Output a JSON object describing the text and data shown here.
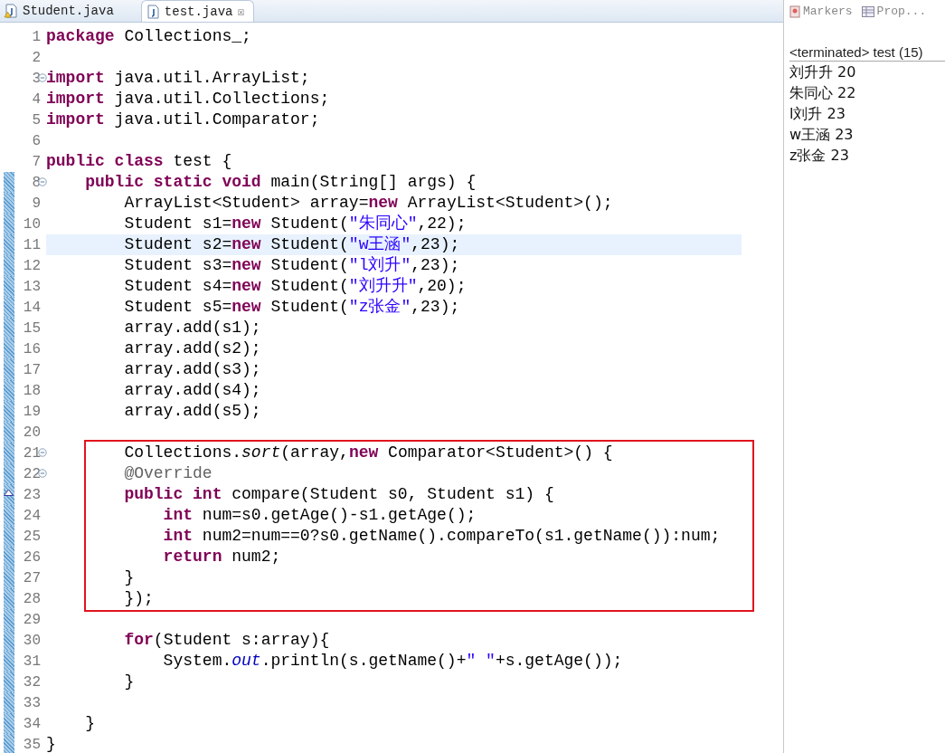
{
  "editor_tabs": [
    {
      "label": "Student.java",
      "selected": false,
      "warning": true
    },
    {
      "label": "test.java",
      "selected": true,
      "warning": false,
      "close": "☒"
    }
  ],
  "code_lines": [
    {
      "number": "1",
      "current": false,
      "boxed": false,
      "range": false,
      "tokens": [
        {
          "kind": "keyword",
          "text": "package"
        },
        {
          "kind": "plain",
          "text": " Collections_;"
        }
      ]
    },
    {
      "number": "2",
      "current": false,
      "boxed": false,
      "range": false
    },
    {
      "number": "3",
      "current": false,
      "boxed": false,
      "range": false,
      "kind": "fold",
      "tokens": [
        {
          "kind": "keyword",
          "text": "import"
        },
        {
          "kind": "plain",
          "text": " java.util.ArrayList;"
        }
      ]
    },
    {
      "number": "4",
      "current": false,
      "boxed": false,
      "range": false,
      "tokens": [
        {
          "kind": "keyword",
          "text": "import"
        },
        {
          "kind": "plain",
          "text": " java.util.Collections;"
        }
      ]
    },
    {
      "number": "5",
      "current": false,
      "boxed": false,
      "range": false,
      "tokens": [
        {
          "kind": "keyword",
          "text": "import"
        },
        {
          "kind": "plain",
          "text": " java.util.Comparator;"
        }
      ]
    },
    {
      "number": "6",
      "current": false,
      "boxed": false,
      "range": false
    },
    {
      "number": "7",
      "current": false,
      "boxed": false,
      "range": false,
      "tokens": [
        {
          "kind": "keyword",
          "text": "public class"
        },
        {
          "kind": "plain",
          "text": " test {"
        }
      ]
    },
    {
      "number": "8",
      "current": false,
      "boxed": false,
      "range": true,
      "kind": "fold",
      "tokens": [
        {
          "kind": "keyword",
          "text": "    public static void"
        },
        {
          "kind": "plain",
          "text": " main(String[] args) {"
        }
      ]
    },
    {
      "number": "9",
      "current": false,
      "boxed": false,
      "range": true,
      "tokens": [
        {
          "kind": "plain",
          "text": "        ArrayList<Student> array="
        },
        {
          "kind": "keyword",
          "text": "new"
        },
        {
          "kind": "plain",
          "text": " ArrayList<Student>();"
        }
      ]
    },
    {
      "number": "10",
      "current": false,
      "boxed": false,
      "range": true,
      "tokens": [
        {
          "kind": "plain",
          "text": "        Student s1="
        },
        {
          "kind": "keyword",
          "text": "new"
        },
        {
          "kind": "plain",
          "text": " Student("
        },
        {
          "kind": "string",
          "text": "\"朱同心\""
        },
        {
          "kind": "plain",
          "text": ",22);"
        }
      ]
    },
    {
      "number": "11",
      "current": true,
      "boxed": false,
      "range": true,
      "tokens": [
        {
          "kind": "plain",
          "text": "        Student s2="
        },
        {
          "kind": "keyword",
          "text": "new"
        },
        {
          "kind": "plain",
          "text": " Student("
        },
        {
          "kind": "string",
          "text": "\"w王涵\""
        },
        {
          "kind": "plain",
          "text": ",23);"
        }
      ]
    },
    {
      "number": "12",
      "current": false,
      "boxed": false,
      "range": true,
      "tokens": [
        {
          "kind": "plain",
          "text": "        Student s3="
        },
        {
          "kind": "keyword",
          "text": "new"
        },
        {
          "kind": "plain",
          "text": " Student("
        },
        {
          "kind": "string",
          "text": "\"l刘升\""
        },
        {
          "kind": "plain",
          "text": ",23);"
        }
      ]
    },
    {
      "number": "13",
      "current": false,
      "boxed": false,
      "range": true,
      "tokens": [
        {
          "kind": "plain",
          "text": "        Student s4="
        },
        {
          "kind": "keyword",
          "text": "new"
        },
        {
          "kind": "plain",
          "text": " Student("
        },
        {
          "kind": "string",
          "text": "\"刘升升\""
        },
        {
          "kind": "plain",
          "text": ",20);"
        }
      ]
    },
    {
      "number": "14",
      "current": false,
      "boxed": false,
      "range": true,
      "tokens": [
        {
          "kind": "plain",
          "text": "        Student s5="
        },
        {
          "kind": "keyword",
          "text": "new"
        },
        {
          "kind": "plain",
          "text": " Student("
        },
        {
          "kind": "string",
          "text": "\"z张金\""
        },
        {
          "kind": "plain",
          "text": ",23);"
        }
      ]
    },
    {
      "number": "15",
      "current": false,
      "boxed": false,
      "range": true,
      "tokens": [
        {
          "kind": "plain",
          "text": "        array.add(s1);"
        }
      ]
    },
    {
      "number": "16",
      "current": false,
      "boxed": false,
      "range": true,
      "tokens": [
        {
          "kind": "plain",
          "text": "        array.add(s2);"
        }
      ]
    },
    {
      "number": "17",
      "current": false,
      "boxed": false,
      "range": true,
      "tokens": [
        {
          "kind": "plain",
          "text": "        array.add(s3);"
        }
      ]
    },
    {
      "number": "18",
      "current": false,
      "boxed": false,
      "range": true,
      "tokens": [
        {
          "kind": "plain",
          "text": "        array.add(s4);"
        }
      ]
    },
    {
      "number": "19",
      "current": false,
      "boxed": false,
      "range": true,
      "tokens": [
        {
          "kind": "plain",
          "text": "        array.add(s5);"
        }
      ]
    },
    {
      "number": "20",
      "current": false,
      "boxed": false,
      "range": true
    },
    {
      "number": "21",
      "current": false,
      "boxed": true,
      "range": true,
      "kind": "fold",
      "tokens": [
        {
          "kind": "plain",
          "text": "        Collections."
        },
        {
          "kind": "static_method",
          "text": "sort"
        },
        {
          "kind": "plain",
          "text": "(array,"
        },
        {
          "kind": "keyword",
          "text": "new"
        },
        {
          "kind": "plain",
          "text": " Comparator<Student>() {"
        }
      ]
    },
    {
      "number": "22",
      "current": false,
      "boxed": true,
      "range": true,
      "kind": "fold",
      "tokens": [
        {
          "kind": "annotation",
          "text": "        @Override"
        }
      ]
    },
    {
      "number": "23",
      "current": false,
      "boxed": true,
      "range": true,
      "kind": "override",
      "tokens": [
        {
          "kind": "keyword",
          "text": "        public int"
        },
        {
          "kind": "plain",
          "text": " compare(Student s0, Student s1) {"
        }
      ]
    },
    {
      "number": "24",
      "current": false,
      "boxed": true,
      "range": true,
      "tokens": [
        {
          "kind": "keyword",
          "text": "            int"
        },
        {
          "kind": "plain",
          "text": " num=s0.getAge()-s1.getAge();"
        }
      ]
    },
    {
      "number": "25",
      "current": false,
      "boxed": true,
      "range": true,
      "tokens": [
        {
          "kind": "keyword",
          "text": "            int"
        },
        {
          "kind": "plain",
          "text": " num2=num==0?s0.getName().compareTo(s1.getName()):num;"
        }
      ]
    },
    {
      "number": "26",
      "current": false,
      "boxed": true,
      "range": true,
      "tokens": [
        {
          "kind": "keyword",
          "text": "            return"
        },
        {
          "kind": "plain",
          "text": " num2;"
        }
      ]
    },
    {
      "number": "27",
      "current": false,
      "boxed": true,
      "range": true,
      "tokens": [
        {
          "kind": "plain",
          "text": "        }"
        }
      ]
    },
    {
      "number": "28",
      "current": false,
      "boxed": true,
      "range": true,
      "tokens": [
        {
          "kind": "plain",
          "text": "        });"
        }
      ]
    },
    {
      "number": "29",
      "current": false,
      "boxed": false,
      "range": true
    },
    {
      "number": "30",
      "current": false,
      "boxed": false,
      "range": true,
      "tokens": [
        {
          "kind": "keyword",
          "text": "        for"
        },
        {
          "kind": "plain",
          "text": "(Student s:array){"
        }
      ]
    },
    {
      "number": "31",
      "current": false,
      "boxed": false,
      "range": true,
      "tokens": [
        {
          "kind": "plain",
          "text": "            System."
        },
        {
          "kind": "static_field",
          "text": "out"
        },
        {
          "kind": "plain",
          "text": ".println(s.getName()+"
        },
        {
          "kind": "string",
          "text": "\" \""
        },
        {
          "kind": "plain",
          "text": "+s.getAge());"
        }
      ]
    },
    {
      "number": "32",
      "current": false,
      "boxed": false,
      "range": true,
      "tokens": [
        {
          "kind": "plain",
          "text": "        }"
        }
      ]
    },
    {
      "number": "33",
      "current": false,
      "boxed": false,
      "range": true
    },
    {
      "number": "34",
      "current": false,
      "boxed": false,
      "range": true,
      "tokens": [
        {
          "kind": "plain",
          "text": "    }"
        }
      ]
    },
    {
      "number": "35",
      "current": false,
      "boxed": false,
      "range": true,
      "tokens": [
        {
          "kind": "plain",
          "text": "}"
        }
      ]
    }
  ],
  "side_tabs": [
    {
      "label": "Markers",
      "kind": "markers"
    },
    {
      "label": "Prop...",
      "kind": "properties"
    }
  ],
  "console": {
    "header": "<terminated> test (15)",
    "output": [
      "刘升升 20",
      "朱同心 22",
      "l刘升 23",
      "w王涵 23",
      "z张金 23"
    ]
  }
}
